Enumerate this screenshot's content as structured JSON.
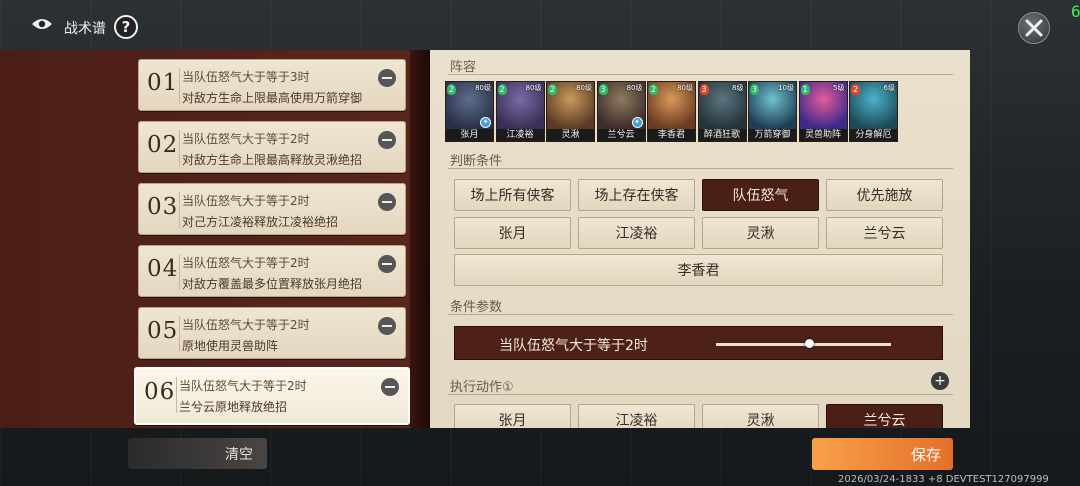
{
  "header": {
    "title": "战术谱",
    "help_label": "?",
    "corner_digit": "6"
  },
  "tactics": [
    {
      "num": "01",
      "line1": "当队伍怒气大于等于3时",
      "line2": "对敌方生命上限最高使用万箭穿御"
    },
    {
      "num": "02",
      "line1": "当队伍怒气大于等于2时",
      "line2": "对敌方生命上限最高释放灵湫绝招"
    },
    {
      "num": "03",
      "line1": "当队伍怒气大于等于2时",
      "line2": "对己方江凌裕释放江凌裕绝招"
    },
    {
      "num": "04",
      "line1": "当队伍怒气大于等于2时",
      "line2": "对敌方覆盖最多位置释放张月绝招"
    },
    {
      "num": "05",
      "line1": "当队伍怒气大于等于2时",
      "line2": "原地使用灵兽助阵"
    },
    {
      "num": "06",
      "line1": "当队伍怒气大于等于2时",
      "line2": "兰兮云原地释放绝招"
    }
  ],
  "lineup": {
    "title": "阵容",
    "heroes": [
      {
        "name": "张月",
        "level": "80级",
        "rank": "2",
        "colors": [
          "#5b6f8f",
          "#2c2f46"
        ],
        "rank_color": "#2fb86a",
        "badge": "✦"
      },
      {
        "name": "江凌裕",
        "level": "80级",
        "rank": "2",
        "colors": [
          "#7b6aa6",
          "#3b2f55"
        ],
        "rank_color": "#2fb86a",
        "badge": ""
      },
      {
        "name": "灵湫",
        "level": "80级",
        "rank": "2",
        "colors": [
          "#c99a5a",
          "#5b3b25"
        ],
        "rank_color": "#2fb86a",
        "badge": ""
      },
      {
        "name": "兰兮云",
        "level": "80级",
        "rank": "3",
        "colors": [
          "#8f7a62",
          "#3c2e28"
        ],
        "rank_color": "#2fb86a",
        "badge": "✦"
      },
      {
        "name": "李香君",
        "level": "80级",
        "rank": "2",
        "colors": [
          "#d99a5a",
          "#6a3a22"
        ],
        "rank_color": "#2fb86a",
        "badge": ""
      },
      {
        "name": "醉酒狂歌",
        "level": "8级",
        "rank": "3",
        "colors": [
          "#5a7580",
          "#24343a"
        ],
        "rank_color": "#e2442f",
        "badge": ""
      },
      {
        "name": "万箭穿御",
        "level": "10级",
        "rank": "3",
        "colors": [
          "#6fc2d0",
          "#1e3e52"
        ],
        "rank_color": "#2fb86a",
        "badge": ""
      },
      {
        "name": "灵兽助阵",
        "level": "5级",
        "rank": "1",
        "colors": [
          "#e45b9a",
          "#3a2a8a"
        ],
        "rank_color": "#2fb86a",
        "badge": ""
      },
      {
        "name": "分身解厄",
        "level": "6级",
        "rank": "2",
        "colors": [
          "#4bb3c9",
          "#1e4a58"
        ],
        "rank_color": "#e2442f",
        "badge": ""
      }
    ]
  },
  "condition": {
    "title": "判断条件",
    "buttons": [
      "场上所有侠客",
      "场上存在侠客",
      "队伍怒气",
      "优先施放",
      "张月",
      "江凌裕",
      "灵湫",
      "兰兮云",
      "李香君"
    ],
    "active_index": 2
  },
  "params": {
    "title": "条件参数",
    "text": "当队伍怒气大于等于2时",
    "slider_fraction": 0.53
  },
  "actions": {
    "title": "执行动作①",
    "add_label": "+",
    "buttons": [
      "张月",
      "江凌裕",
      "灵湫",
      "兰兮云"
    ]
  },
  "footer": {
    "clear_label": "清空",
    "save_label": "保存",
    "build_info": "2026/03/24-1833 +8 DEVTEST127097999"
  }
}
